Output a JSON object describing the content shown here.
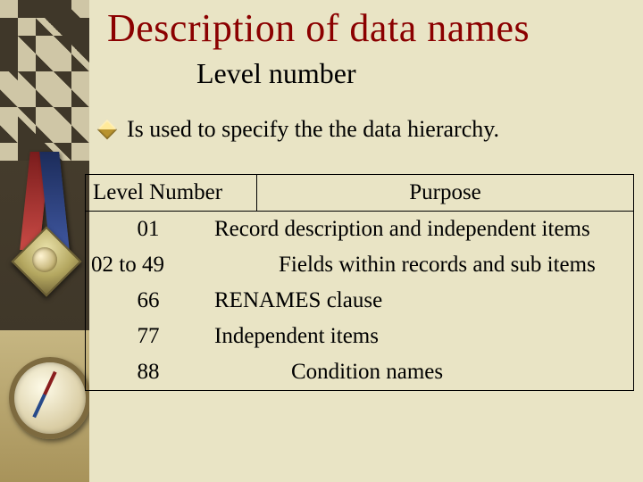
{
  "title": "Description of data names",
  "subtitle": "Level number",
  "bullet": "Is used to specify the the data hierarchy.",
  "table": {
    "headers": {
      "level": "Level Number",
      "purpose": "Purpose"
    },
    "rows": [
      {
        "level": "01",
        "purpose": "Record description and independent items"
      },
      {
        "level": "02  to  49",
        "purpose": "Fields within records and sub items"
      },
      {
        "level": "66",
        "purpose": "RENAMES clause"
      },
      {
        "level": "77",
        "purpose": "Independent items"
      },
      {
        "level": "88",
        "purpose": "Condition names"
      }
    ]
  }
}
